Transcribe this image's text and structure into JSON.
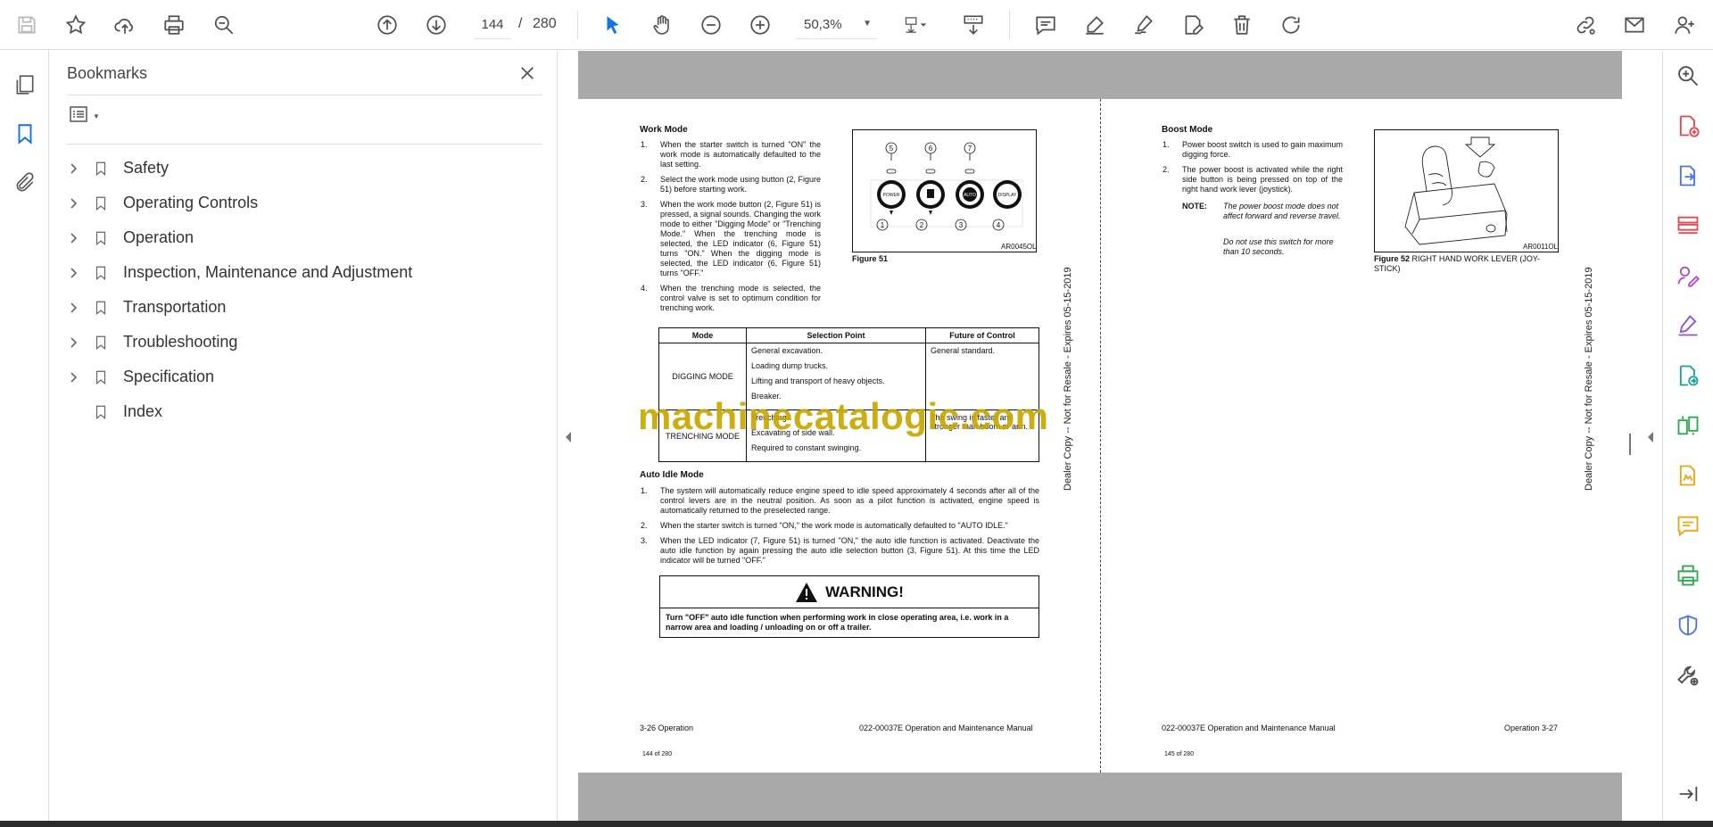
{
  "toolbar": {
    "page_current": "144",
    "page_separator": "/",
    "page_total": "280",
    "zoom_value": "50,3%"
  },
  "bookmarks_panel": {
    "title": "Bookmarks",
    "items": [
      {
        "label": "Safety",
        "expandable": true
      },
      {
        "label": "Operating Controls",
        "expandable": true
      },
      {
        "label": "Operation",
        "expandable": true
      },
      {
        "label": "Inspection, Maintenance and Adjustment",
        "expandable": true
      },
      {
        "label": "Transportation",
        "expandable": true
      },
      {
        "label": "Troubleshooting",
        "expandable": true
      },
      {
        "label": "Specification",
        "expandable": true
      },
      {
        "label": "Index",
        "expandable": false
      }
    ]
  },
  "left_page": {
    "work_mode_heading": "Work Mode",
    "work_mode_items": [
      {
        "num": "1.",
        "text": "When the starter switch is turned \"ON\" the work mode is automatically defaulted to the last setting."
      },
      {
        "num": "2.",
        "text": "Select the work mode using button (2, Figure 51) before starting work."
      },
      {
        "num": "3.",
        "text": "When the work mode button (2, Figure 51) is pressed, a signal sounds. Changing the work mode to either \"Digging Mode\" or \"Trenching Mode.\" When the trenching mode is selected, the LED indicator (6, Figure 51) turns \"ON.\" When the digging mode is selected, the LED indicator (6, Figure 51) turns \"OFF.\""
      },
      {
        "num": "4.",
        "text": "When the trenching mode is selected, the control valve is set to optimum condition for trenching work."
      }
    ],
    "figure51": {
      "caption": "Figure 51",
      "code": "AR0045OL",
      "top_labels": [
        "5",
        "6",
        "7"
      ],
      "bottom_labels": [
        "1",
        "2",
        "3",
        "4"
      ],
      "button_labels": [
        "POWER",
        "",
        "AUTO",
        "DISPLAY"
      ]
    },
    "table": {
      "headers": [
        "Mode",
        "Selection Point",
        "Future of Control"
      ],
      "rows": [
        {
          "mode": "DIGGING MODE",
          "points": [
            "General excavation.",
            "Loading dump trucks.",
            "Lifting and transport of heavy objects.",
            "Breaker."
          ],
          "future": "General standard."
        },
        {
          "mode": "TRENCHING MODE",
          "points": [
            "Trenching.",
            "Excavating of side wall.",
            "Required to constant swinging."
          ],
          "future": "The swing is faster and stronger than boom or arm."
        }
      ]
    },
    "auto_idle_heading": "Auto Idle Mode",
    "auto_idle_items": [
      {
        "num": "1.",
        "text": "The system will automatically reduce engine speed to idle speed approximately 4 seconds after all of the control levers are in the neutral position. As soon as a pilot function is activated, engine speed is automatically returned to the preselected range."
      },
      {
        "num": "2.",
        "text": "When the starter switch is turned \"ON,\" the work mode is automatically defaulted to \"AUTO IDLE.\""
      },
      {
        "num": "3.",
        "text": "When the LED indicator (7, Figure 51) is turned \"ON,\" the auto idle function is activated. Deactivate the auto idle function by again pressing the auto idle selection button (3, Figure 51). At this time the LED indicator will be turned \"OFF.\""
      }
    ],
    "warning_title": "WARNING!",
    "warning_text": "Turn \"OFF\" auto idle function when performing work in close operating area, i.e. work in a narrow area and loading / unloading on or off a trailer.",
    "footer_left": "3-26  Operation",
    "footer_right": "022-00037E Operation and Maintenance Manual",
    "footer_page": "144 of 280",
    "stamp": "Dealer Copy -- Not for Resale - Expires 05-15-2019"
  },
  "right_page": {
    "boost_heading": "Boost Mode",
    "boost_items": [
      {
        "num": "1.",
        "text": "Power boost switch is used to gain maximum digging force."
      },
      {
        "num": "2.",
        "text": "The power boost is activated while the right side button is being pressed on top of the right hand work lever (joystick)."
      }
    ],
    "note_label": "NOTE:",
    "note_lines": [
      "The power boost mode does not affect forward and reverse travel.",
      "Do not use this switch for more than 10 seconds."
    ],
    "figure52": {
      "caption_bold": "Figure 52",
      "caption_text": " RIGHT HAND WORK LEVER (JOY-STICK)",
      "code": "AR0011OL"
    },
    "footer_left": "022-00037E Operation and Maintenance Manual",
    "footer_right": "Operation 3-27",
    "footer_page": "145 of 280",
    "stamp": "Dealer Copy -- Not for Resale - Expires 05-15-2019"
  },
  "watermark": "machinecatalogic.com"
}
